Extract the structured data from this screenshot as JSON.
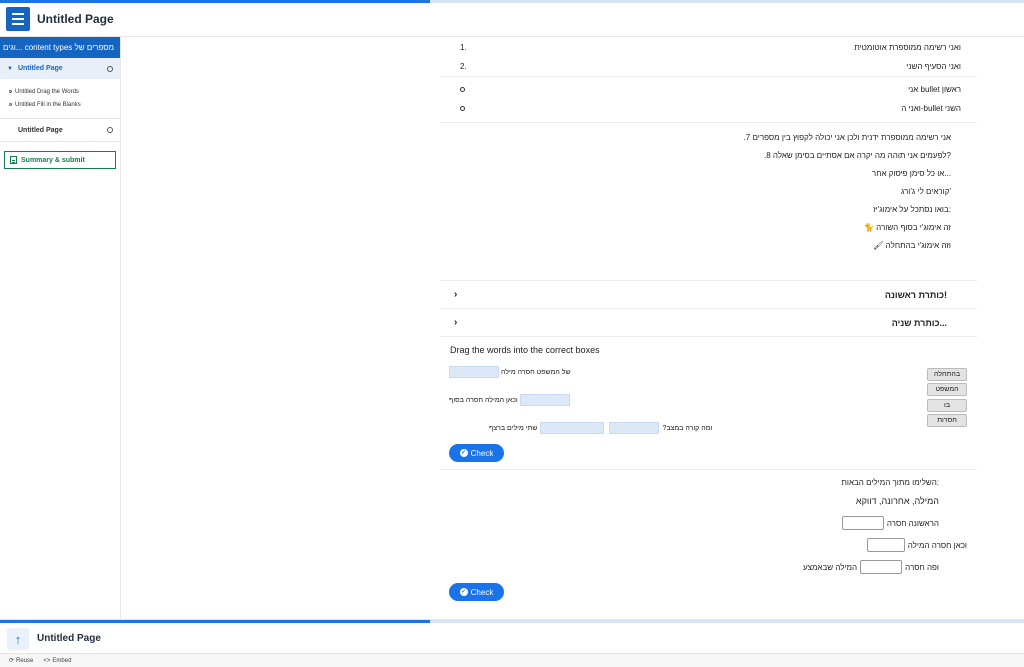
{
  "header": {
    "title": "Untitled Page",
    "progress_fraction": 0.42
  },
  "sidebar": {
    "header_label": "מספרים של content types ...וגים",
    "page1": {
      "label": "Untitled Page"
    },
    "sub_items": [
      "Untitled Drag the Words",
      "Untitled Fill in the Blanks"
    ],
    "page2": {
      "label": "Untitled Page"
    },
    "summary_label": "Summary & submit"
  },
  "content": {
    "ordered_list": [
      {
        "text": "ואני רשימה ממוספרת אוטומטית",
        "num": "1."
      },
      {
        "text": "ואני הסעיף השני",
        "num": "2."
      }
    ],
    "bullet_list": [
      "ראשון bullet אני",
      "השני bullet-ואני ה"
    ],
    "text_lines": [
      "אני רשימה ממוספרת ידנית ולכן אני יכולה לקפוץ בין מספרים 7.",
      "?לפעמים אני תוהה מה יקרה אם אסתיים בסימן שאלה 8.",
      "...או כל סימן פיסוק אחר",
      "'קוראים לי ג'ורג",
      ":בואו נסתכל על אימוג'יז",
      "זה אימוג'י בסוף השורה",
      "וזה אימוג'י בהתחלה"
    ],
    "accordion": [
      {
        "title": "!כותרת ראשונה"
      },
      {
        "title": "...כותרת שניה"
      }
    ],
    "drag_words": {
      "title": "Drag the words into the correct boxes",
      "line1_text": "של המשפט חסרה מילה",
      "line2_text": "וכאן המילה חסרה בסוף",
      "line3_pre": "?ומה קורה במצב",
      "line3_post": "שתי מילים ברצף",
      "words": [
        "בהתחלה",
        "המשפט",
        "בו",
        "חסרות"
      ],
      "check_label": "Check"
    },
    "fill_blanks": {
      "instruction": ":השלימו מתוך המילים הבאות",
      "word_bank": "המילה, אחרונה, דווקא",
      "line1": "הראשונה חסרה",
      "line2": "וכאן חסרה המילה",
      "line3_pre": "ופה חסרה",
      "line3_post": "המילה שבאמצע",
      "check_label": "Check"
    }
  },
  "bottom": {
    "title": "Untitled Page",
    "progress_fraction": 0.42
  },
  "footer": {
    "reuse_label": "Reuse",
    "embed_label": "Embed"
  },
  "colors": {
    "accent": "#1565c0",
    "button": "#1a73e8",
    "summary": "#1b7a4a"
  }
}
